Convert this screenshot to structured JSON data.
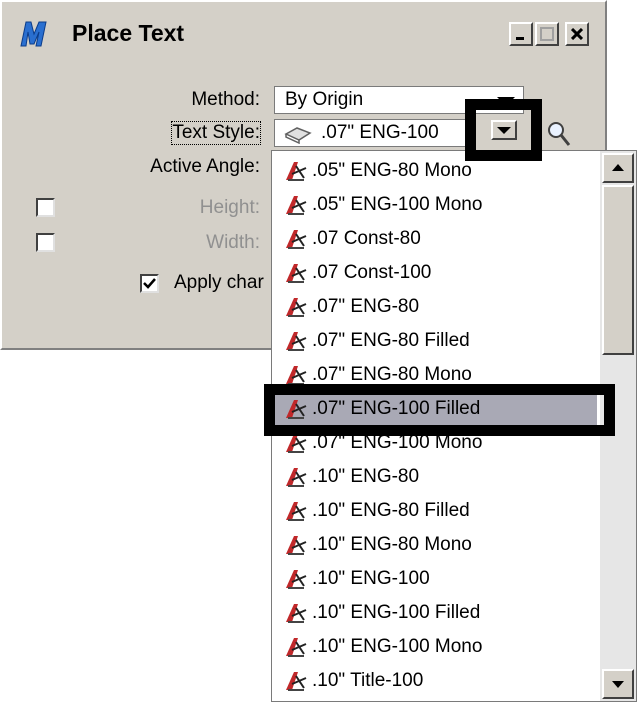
{
  "window": {
    "title": "Place Text"
  },
  "form": {
    "method_label": "Method:",
    "method_value": "By Origin",
    "text_style_label": "Text Style:",
    "text_style_value": ".07\"  ENG-100",
    "active_angle_label": "Active Angle:",
    "height_label": "Height:",
    "width_label": "Width:",
    "apply_label": "Apply char",
    "height_checked": false,
    "width_checked": false,
    "apply_checked": true
  },
  "dropdown": {
    "items": [
      ".05\"  ENG-80 Mono",
      ".05\"  ENG-100 Mono",
      ".07 Const-80",
      ".07 Const-100",
      ".07\"  ENG-80",
      ".07\"  ENG-80 Filled",
      ".07\"  ENG-80 Mono",
      ".07\"  ENG-100 Filled",
      ".07\"  ENG-100 Mono",
      ".10\"  ENG-80",
      ".10\"  ENG-80 Filled",
      ".10\"  ENG-80 Mono",
      ".10\"  ENG-100",
      ".10\"  ENG-100 Filled",
      ".10\"  ENG-100 Mono",
      ".10\" Title-100"
    ],
    "selected_index": 7
  },
  "colors": {
    "selection": "#a9a9b5",
    "dialog": "#d4d0c8",
    "icon_red": "#c0282a"
  },
  "icons": [
    "microstation-icon",
    "text-style-icon",
    "magnifier-icon",
    "minimize-icon",
    "maximize-icon",
    "close-icon"
  ]
}
